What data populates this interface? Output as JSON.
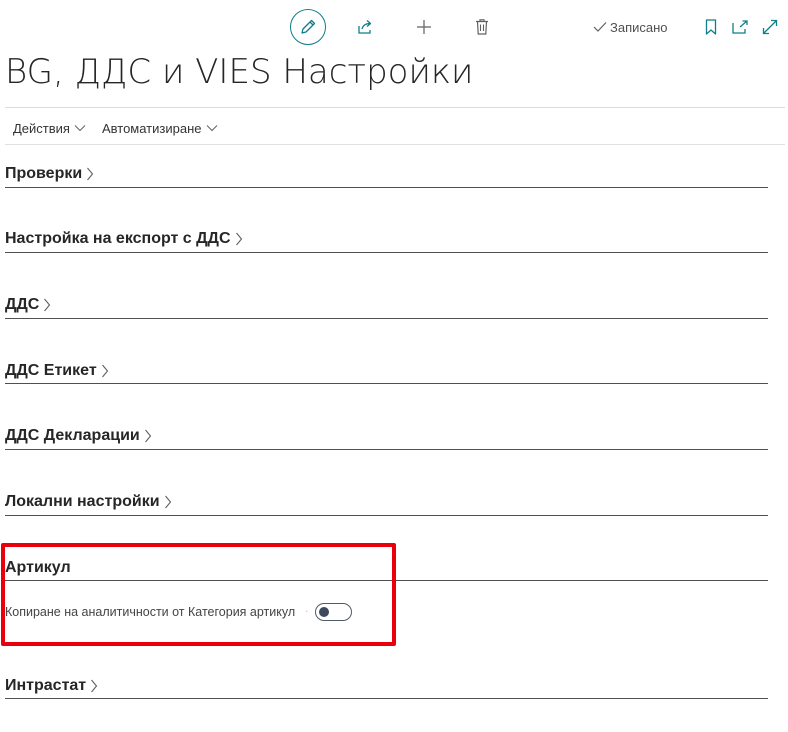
{
  "toolbar": {
    "edit_icon": "pencil-icon",
    "share_icon": "share-icon",
    "new_icon": "plus-icon",
    "delete_icon": "trash-icon",
    "saved_label": "Записано",
    "bookmark_icon": "bookmark-icon",
    "open_new_window_icon": "open-in-new-window-icon",
    "expand_icon": "expand-icon",
    "accent_color": "#0f7f88"
  },
  "page": {
    "title": "BG, ДДС и VIES Настройки"
  },
  "actions": {
    "menu1": "Действия",
    "menu2": "Автоматизиране"
  },
  "sections": [
    {
      "label": "Проверки"
    },
    {
      "label": "Настройка на експорт с ДДС"
    },
    {
      "label": "ДДС"
    },
    {
      "label": "ДДС Етикет"
    },
    {
      "label": "ДДС Декларации"
    },
    {
      "label": "Локални настройки"
    },
    {
      "label": "Артикул"
    },
    {
      "label": "Интрастат"
    }
  ],
  "item_section": {
    "field_label": "Копиране на аналитичности от Категория артикул",
    "toggle_on": false,
    "highlight_color": "#e8000b"
  }
}
